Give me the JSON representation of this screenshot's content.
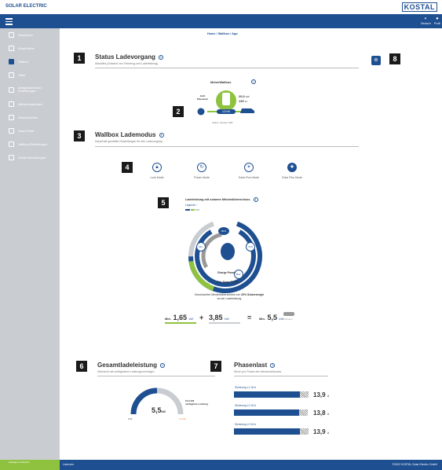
{
  "brand": "SOLAR ELECTRIC",
  "logo": "KOSTAL",
  "nav": {
    "lang": "Deutsch",
    "profile": "Profil"
  },
  "breadcrumb": "Home / Wallbox / App",
  "sidebar": {
    "items": [
      {
        "label": "Dashboard",
        "icon": "dashboard-icon"
      },
      {
        "label": "Smart Meter",
        "icon": "meter-icon"
      },
      {
        "label": "Wallbox",
        "icon": "wallbox-icon"
      },
      {
        "label": "Tarife",
        "icon": "tariff-icon"
      },
      {
        "label": "Anlagenübersicht / Einstellungen",
        "icon": "plant-icon"
      },
      {
        "label": "Aktivierungscodes",
        "icon": "activation-icon"
      },
      {
        "label": "Wechselrichter",
        "icon": "inverter-icon"
      },
      {
        "label": "Solar Portal",
        "icon": "portal-icon"
      },
      {
        "label": "Wallbox-Einstellungen",
        "icon": "wallbox-settings-icon"
      },
      {
        "label": "Geräte-Einstellungen",
        "icon": "device-settings-icon"
      }
    ]
  },
  "green_box": "intelligent verbinden",
  "footer": {
    "left": "Lizenzen",
    "right": "©2022 KOSTAL Solar Electric GmbH"
  },
  "markers": [
    "1",
    "2",
    "3",
    "4",
    "5",
    "6",
    "7",
    "8"
  ],
  "status": {
    "title": "Status Ladevorgang",
    "sub": "Aktuelles (Zustand von Fahrzeug und Ladeleistung)",
    "device": "MeineWallbox",
    "left_label": "Jetzt Pausieren",
    "power": "3,8 kW",
    "right_value": "20,0",
    "right_unit": "kWh",
    "right_value2": "130",
    "right_unit2": "km",
    "plug": "Status: Stecker 5kB"
  },
  "mode": {
    "title": "Wallbox Lademodus",
    "sub": "Dauerhaft gewählte Einstellungen für den Ladevorgang",
    "items": [
      {
        "label": "Lock Mode",
        "icon": "lock-icon"
      },
      {
        "label": "Power Mode",
        "icon": "power-icon"
      },
      {
        "label": "Solar Pure Mode",
        "icon": "sun-icon"
      },
      {
        "label": "Solar Plus Mode",
        "icon": "solar-plus-icon"
      }
    ]
  },
  "charge": {
    "title": "Ladeleistung mit solarem Mindestüberschuss",
    "legend": "Legende",
    "ring_top": "80%",
    "ring_left": "Min.",
    "ring_right": "70%",
    "ring_bottom": "Max.",
    "charge_power": "Charge Power",
    "min_solar": "Min. Solar Power",
    "desc1": "Gewünschter Mindestüberschuss von",
    "desc_bold": "20% Solarenergie",
    "desc2": "an der Ladeleistung",
    "progress": {
      "green": 0.22,
      "grey": 0.78
    }
  },
  "sums": {
    "min_label": "Min.",
    "a": "1,65",
    "a_unit": "kW",
    "plus": "+",
    "b": "3,85",
    "b_unit": "kW",
    "eq": "=",
    "c_label": "Min.",
    "c": "5,5",
    "c_unit": "kW",
    "phases": "3 Phasen"
  },
  "total": {
    "title": "Gesamtladeleistung",
    "sub": "Übersicht mit verfügbarem Leistungsvermögen",
    "value": "5,5",
    "unit": "kW",
    "min": "0 W",
    "max": "11 kW",
    "avail": "10,0 kW",
    "avail_label": "verfügbare Leistung",
    "fill": 0.5
  },
  "phase": {
    "title": "Phasenlast",
    "sub": "Strom pro Phase des Netzanschlusses",
    "rows": [
      {
        "label": "Sicherung L1",
        "max": "16 A",
        "value": "13,9",
        "unit": "A",
        "fill": 0.87
      },
      {
        "label": "Sicherung L2",
        "max": "16 A",
        "value": "13,8",
        "unit": "A",
        "fill": 0.86
      },
      {
        "label": "Sicherung L3",
        "max": "16 A",
        "value": "13,9",
        "unit": "A",
        "fill": 0.87
      }
    ]
  },
  "colors": {
    "blue": "#1d4f91",
    "green": "#8fc33f",
    "grey": "#c9cdd1"
  }
}
